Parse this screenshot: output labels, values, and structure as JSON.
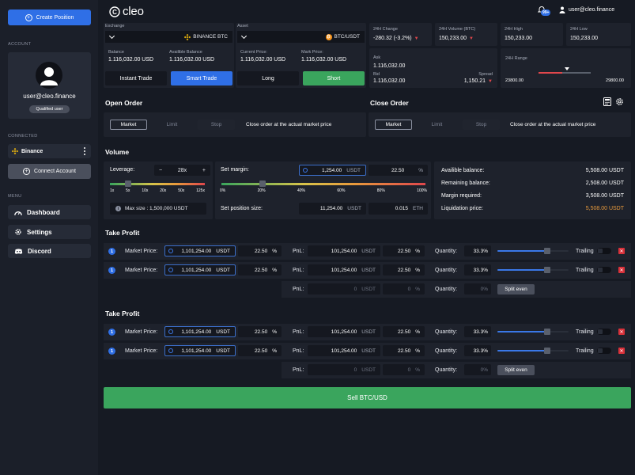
{
  "sidebar": {
    "create_position": "Create Position",
    "account_label": "ACCOUNT",
    "user_email": "user@cleo.finance",
    "user_status": "Qualified user",
    "connected_label": "CONNECTED",
    "exchange_name": "Binance",
    "connect_account": "Connect Account",
    "menu_label": "MENU",
    "menu": [
      {
        "label": "Dashboard",
        "icon": "dashboard-icon"
      },
      {
        "label": "Settings",
        "icon": "gear-icon"
      },
      {
        "label": "Discord",
        "icon": "discord-icon"
      }
    ]
  },
  "topbar": {
    "logo_text": "cleo",
    "notification_count": "99+",
    "user_email": "user@cleo.finance"
  },
  "exchange": {
    "label": "Exchange",
    "value": "BINANCE BTC",
    "balance_label": "Balance",
    "balance": "1.116,032.00 USD",
    "available_label": "Availible Balance",
    "available": "1.116,032.00 USD",
    "modes": [
      "Instant Trade",
      "Smart Trade"
    ],
    "active_mode": "Smart Trade"
  },
  "asset": {
    "label": "Asset",
    "value": "BTC/USDT",
    "current_price_label": "Current Price:",
    "current_price": "1.116,032.00 USD",
    "mark_price_label": "Mark Price:",
    "mark_price": "1.116,032.00 USD",
    "long_label": "Long",
    "short_label": "Short"
  },
  "stats": {
    "change_label": "24H Change",
    "change": "-280.32 (-3.2%)",
    "volume_label": "24H Volume (BTC)",
    "volume": "150,233.00",
    "high_label": "24H High",
    "high": "150,233.00",
    "low_label": "24H Low",
    "low": "150,233.00",
    "ask_label": "Ask",
    "ask": "1.116,032.00",
    "bid_label": "Bid",
    "bid": "1.116,032.00",
    "spread_label": "Spread",
    "spread": "1,150.21",
    "range_label": "24H Range",
    "range_low": "23800.00",
    "range_high": "29800.00",
    "range_position": 0.55
  },
  "open_order": {
    "title": "Open Order",
    "tabs": [
      "Market",
      "Limit",
      "Stop"
    ],
    "description": "Close order at the  actual market price"
  },
  "close_order": {
    "title": "Close Order",
    "tabs": [
      "Market",
      "Limit",
      "Stop"
    ],
    "description": "Close order at the  actual market price"
  },
  "volume": {
    "title": "Volume",
    "leverage_label": "Leverage:",
    "leverage": "28x",
    "leverage_ticks": [
      "1x",
      "5x",
      "10x",
      "20x",
      "50x",
      "125x"
    ],
    "leverage_position": 0.19,
    "max_size": "Max size : 1,500,000 USDT",
    "set_margin_label": "Set margin:",
    "margin_value": "1,254.00",
    "margin_unit": "USDT",
    "margin_pct": "22.50",
    "pct_unit": "%",
    "margin_ticks": [
      "0%",
      "20%",
      "40%",
      "60%",
      "80%",
      "100%"
    ],
    "margin_position": 0.2,
    "position_size_label": "Set position size:",
    "position_size": "11,254.00",
    "position_unit": "USDT",
    "position_eth": "0.015",
    "eth_unit": "ETH",
    "available_balance_label": "Availible balance:",
    "available_balance": "5,508.00 USDT",
    "remaining_balance_label": "Remaining balance:",
    "remaining_balance": "2,508.00 USDT",
    "margin_required_label": "Margin required:",
    "margin_required": "3,508.00 USDT",
    "liquidation_label": "Liquidation price:",
    "liquidation": "5,508.00 USDT"
  },
  "take_profit_1": {
    "title": "Take Profit",
    "rows": [
      {
        "num": "1",
        "market_label": "Market Price:",
        "price": "1,101,254.00",
        "unit": "USDT",
        "pct": "22.50",
        "pnl_label": "PnL:",
        "pnl": "101,254.00",
        "pnl_unit": "USDT",
        "pnl_pct": "22.50",
        "qty_label": "Quantity:",
        "qty": "33.3%",
        "qty_position": 0.7,
        "trailing_label": "Trailing"
      },
      {
        "num": "1",
        "market_label": "Market Price:",
        "price": "1,101,254.00",
        "unit": "USDT",
        "pct": "22.50",
        "pnl_label": "PnL:",
        "pnl": "101,254.00",
        "pnl_unit": "USDT",
        "pnl_pct": "22.50",
        "qty_label": "Quantity:",
        "qty": "33.3%",
        "qty_position": 0.7,
        "trailing_label": "Trailing"
      }
    ],
    "summary": {
      "pnl_label": "PnL:",
      "pnl": "0",
      "pnl_unit": "USDT",
      "pnl_pct": "0",
      "qty_label": "Quantity:",
      "qty": "0%",
      "split_label": "Split even"
    }
  },
  "take_profit_2": {
    "title": "Take Profit",
    "rows": [
      {
        "num": "1",
        "market_label": "Market Price:",
        "price": "1,101,254.00",
        "unit": "USDT",
        "pct": "22.50",
        "pnl_label": "PnL:",
        "pnl": "101,254.00",
        "pnl_unit": "USDT",
        "pnl_pct": "22.50",
        "qty_label": "Quantity:",
        "qty": "33.3%",
        "qty_position": 0.7,
        "trailing_label": "Trailing"
      },
      {
        "num": "1",
        "market_label": "Market Price:",
        "price": "1,101,254.00",
        "unit": "USDT",
        "pct": "22.50",
        "pnl_label": "PnL:",
        "pnl": "101,254.00",
        "pnl_unit": "USDT",
        "pnl_pct": "22.50",
        "qty_label": "Quantity:",
        "qty": "33.3%",
        "qty_position": 0.7,
        "trailing_label": "Trailing"
      }
    ],
    "summary": {
      "pnl_label": "PnL:",
      "pnl": "0",
      "pnl_unit": "USDT",
      "pnl_pct": "0",
      "qty_label": "Quantity:",
      "qty": "0%",
      "split_label": "Split even"
    }
  },
  "sell_button": "Sell BTC/USD",
  "colors": {
    "primary": "#2f6fe6",
    "green": "#3aa55d",
    "red": "#e0474c",
    "orange": "#e89a3c",
    "binance_yellow": "#f0b90b"
  }
}
